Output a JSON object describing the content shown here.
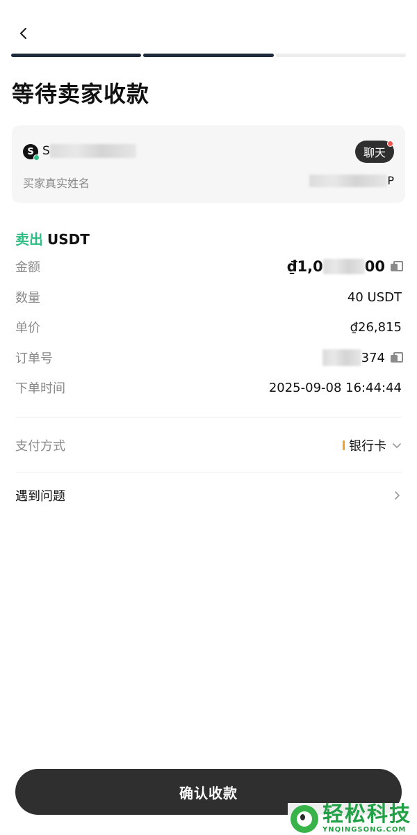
{
  "nav": {
    "back_icon": "chevron-left-icon"
  },
  "progress": {
    "steps_total": 3,
    "steps_done": 2
  },
  "page": {
    "title": "等待卖家收款"
  },
  "buyer": {
    "name_prefix": "S",
    "avatar_letter": "S",
    "chat_label": "聊天",
    "real_name_label": "买家真实姓名",
    "real_name_suffix": "P"
  },
  "order": {
    "side_label": "卖出",
    "coin": "USDT",
    "fields": {
      "amount_label": "金额",
      "amount_prefix": "₫1,0",
      "amount_suffix": "00",
      "quantity_label": "数量",
      "quantity_value": "40 USDT",
      "price_label": "单价",
      "price_value": "₫26,815",
      "order_no_label": "订单号",
      "order_no_suffix": "374",
      "time_label": "下单时间",
      "time_value": "2025-09-08 16:44:44"
    }
  },
  "payment": {
    "label": "支付方式",
    "method": "银行卡"
  },
  "issue": {
    "label": "遇到问题"
  },
  "actions": {
    "confirm_label": "确认收款"
  },
  "watermark": {
    "text_cn": "轻松科技",
    "text_en": "YNQINGSONG.COM"
  },
  "colors": {
    "accent_green": "#2ebd85",
    "primary_dark": "#2f2f2f",
    "progress_done": "#1f2a3d",
    "badge_red": "#f0554f",
    "pay_bar": "#f0a020"
  }
}
